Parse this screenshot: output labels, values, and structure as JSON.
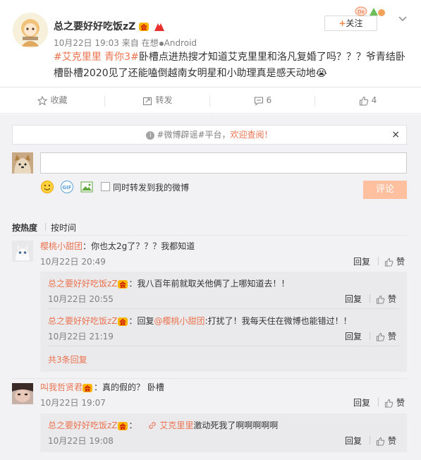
{
  "post": {
    "author": "总之要好好吃饭zZ",
    "date": "10月22日 19:03",
    "from_label": "来自",
    "source": "在想",
    "source_device": "Android",
    "follow_label": "关注",
    "topic1": "#艾克里里 青你3#",
    "body": "卧槽点进热搜才知道艾克里里和洛凡复婚了吗？？？爷青结卧槽卧槽2020见了还能嗑倒越南女明星和小助理真是感天动地",
    "emoji": "😭"
  },
  "actions": {
    "favorite": "收藏",
    "forward": "转发",
    "comment_count": "6",
    "like_count": "4"
  },
  "notice": {
    "prefix": "#微博辟谣#平台，",
    "link": "欢迎查阅！",
    "close": "×"
  },
  "composer": {
    "placeholder": "",
    "also_forward": "同时转发到我的微博",
    "submit": "评论"
  },
  "sort": {
    "hot": "按热度",
    "time": "按时间"
  },
  "comments": [
    {
      "user": "樱桃小甜团",
      "text": "：你也太2g了？？？我都知道",
      "time": "10月22日 20:49",
      "reply": "回复",
      "like": "赞",
      "replies": [
        {
          "user": "总之要好好吃饭zZ",
          "text": "：我八百年前就取关他俩了上哪知道去！！",
          "time": "10月22日 20:55",
          "reply": "回复",
          "like": "赞"
        },
        {
          "user": "总之要好好吃饭zZ",
          "text_prefix": "：回复",
          "mention": "@樱桃小甜团",
          "text": ":打扰了！我每天住在微博也能错过！！",
          "time": "10月22日 21:19",
          "reply": "回复",
          "like": "赞"
        }
      ],
      "more": "共3条回复"
    },
    {
      "user": "叫我哲贤君",
      "text": "：真的假的？ 卧槽",
      "time": "10月22日 19:07",
      "reply": "回复",
      "like": "赞",
      "replies": [
        {
          "user": "总之要好好吃饭zZ",
          "link_text": "艾克里里",
          "text": "激动死我了啊啊啊啊啊",
          "time": "10月22日 19:08",
          "reply": "回复",
          "like": "赞"
        }
      ]
    }
  ],
  "colors": {
    "accent": "#eb7350",
    "submit_bg": "#ffc09f",
    "gray_text": "#808080"
  }
}
